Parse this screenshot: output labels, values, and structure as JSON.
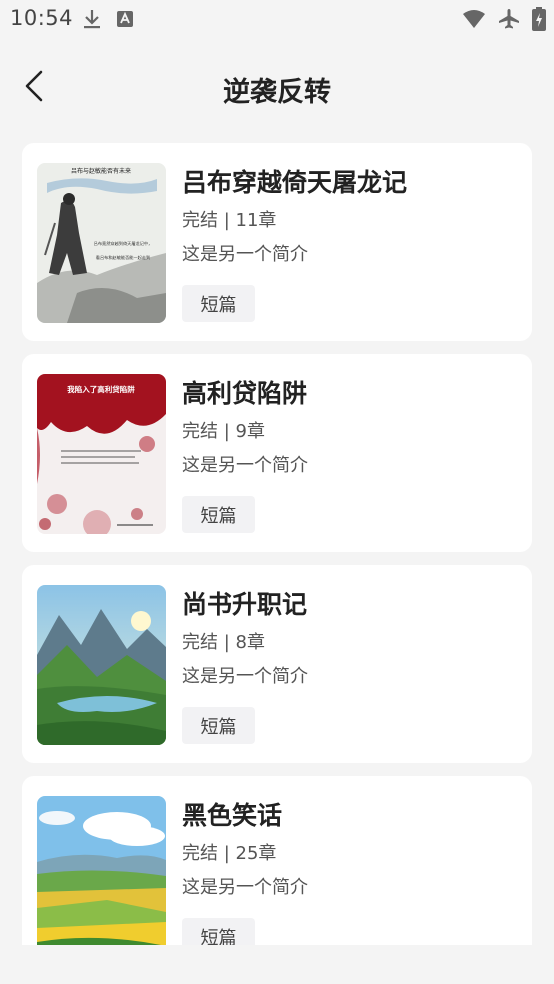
{
  "status_bar": {
    "time": "10:54",
    "left_icons": [
      "download-icon",
      "translate-icon"
    ],
    "right_icons": [
      "wifi-icon",
      "airplane-mode-icon",
      "battery-charging-icon"
    ]
  },
  "header": {
    "title": "逆袭反转",
    "back_icon": "chevron-left-icon"
  },
  "books": [
    {
      "title": "吕布穿越倚天屠龙记",
      "meta": "完结 | 11章",
      "description": "这是另一个简介",
      "tag": "短篇",
      "cover_text": "吕布与赵敏能否有未来",
      "cover_subtext": "吕布竟然穿越到倚天屠龙记中，看吕布和赵敏能否能一起走到",
      "cover_icon": "ink-warrior-cover"
    },
    {
      "title": "高利贷陷阱",
      "meta": "完结 | 9章",
      "description": "这是另一个简介",
      "tag": "短篇",
      "cover_text": "我陷入了高利贷陷阱",
      "cover_icon": "blood-splatter-cover"
    },
    {
      "title": "尚书升职记",
      "meta": "完结 | 8章",
      "description": "这是另一个简介",
      "tag": "短篇",
      "cover_icon": "mountain-lake-cover"
    },
    {
      "title": "黑色笑话",
      "meta": "完结 | 25章",
      "description": "这是另一个简介",
      "tag": "短篇",
      "cover_icon": "countryside-fields-cover"
    }
  ]
}
